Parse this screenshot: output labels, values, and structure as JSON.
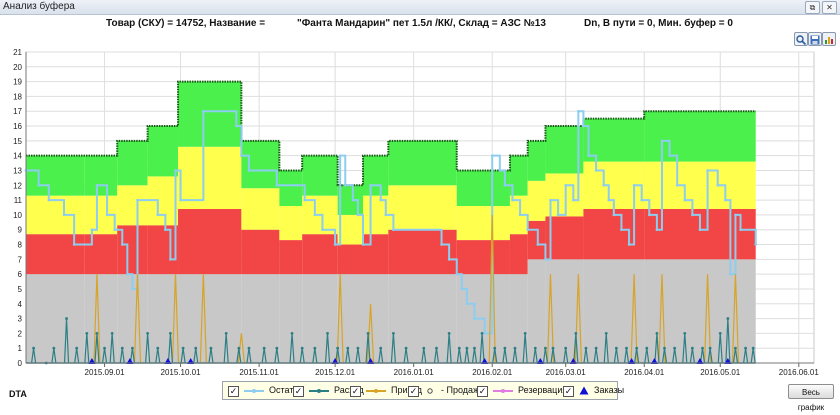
{
  "window": {
    "title": "Анализ буфера"
  },
  "info": {
    "product": "Товар (СКУ) = 14752, Название =",
    "name": "\"Фанта Мандарин\" пет 1.5л /КК/, Склад = АЗС №13",
    "buffer": "Dn, В пути = 0, Мин. буфер = 0"
  },
  "footer": {
    "label": "DTA",
    "button": "Весь график"
  },
  "toolbar": {
    "icons": [
      "zoom-icon",
      "save-icon",
      "chart-icon"
    ]
  },
  "chart_data": {
    "type": "line",
    "x_range": [
      "2015-08-01",
      "2016-06-07"
    ],
    "ylim": [
      0,
      21
    ],
    "yticks": [
      "0",
      "1",
      "2",
      "3",
      "4",
      "5",
      "6",
      "7",
      "8",
      "9",
      "10",
      "11",
      "12",
      "13",
      "14",
      "15",
      "16",
      "17",
      "18",
      "19",
      "20",
      "21"
    ],
    "xticks": [
      {
        "label": "2015.09.01",
        "date": "2015-09-01"
      },
      {
        "label": "2015.10.01",
        "date": "2015-10-01"
      },
      {
        "label": "2015.11.01",
        "date": "2015-11-01"
      },
      {
        "label": "2015.12.01",
        "date": "2015-12-01"
      },
      {
        "label": "2016.01.01",
        "date": "2016-01-01"
      },
      {
        "label": "2016.02.01",
        "date": "2016-02-01"
      },
      {
        "label": "2016.03.01",
        "date": "2016-03-01"
      },
      {
        "label": "2016.04.01",
        "date": "2016-04-01"
      },
      {
        "label": "2016.05.01",
        "date": "2016-05-01"
      },
      {
        "label": "2016.06.01",
        "date": "2016-06-01"
      }
    ],
    "grid": true,
    "zone_colors": {
      "gray": "#c8c8c8",
      "red": "#f24545",
      "yellow": "#ffff4d",
      "green": "#4cf04c"
    },
    "zones": [
      {
        "from": "2015-08-01",
        "to": "2015-08-24",
        "gray": 6,
        "red": 8.7,
        "yellow": 11.3,
        "green": 14
      },
      {
        "from": "2015-08-24",
        "to": "2015-09-06",
        "gray": 6,
        "red": 8.7,
        "yellow": 11.3,
        "green": 14
      },
      {
        "from": "2015-09-06",
        "to": "2015-09-18",
        "gray": 6,
        "red": 9.3,
        "yellow": 12.0,
        "green": 15
      },
      {
        "from": "2015-09-18",
        "to": "2015-09-30",
        "gray": 6,
        "red": 9.3,
        "yellow": 12.6,
        "green": 16
      },
      {
        "from": "2015-09-30",
        "to": "2015-10-25",
        "gray": 6,
        "red": 10.4,
        "yellow": 14.6,
        "green": 19
      },
      {
        "from": "2015-10-25",
        "to": "2015-11-09",
        "gray": 6,
        "red": 9.0,
        "yellow": 11.8,
        "green": 15
      },
      {
        "from": "2015-11-09",
        "to": "2015-11-18",
        "gray": 6,
        "red": 8.3,
        "yellow": 10.6,
        "green": 13
      },
      {
        "from": "2015-11-18",
        "to": "2015-12-02",
        "gray": 6,
        "red": 8.7,
        "yellow": 11.3,
        "green": 14
      },
      {
        "from": "2015-12-02",
        "to": "2015-12-12",
        "gray": 6,
        "red": 8.0,
        "yellow": 10.0,
        "green": 12
      },
      {
        "from": "2015-12-12",
        "to": "2015-12-22",
        "gray": 6,
        "red": 8.7,
        "yellow": 11.3,
        "green": 14
      },
      {
        "from": "2015-12-22",
        "to": "2016-01-18",
        "gray": 6,
        "red": 9.0,
        "yellow": 12.0,
        "green": 15
      },
      {
        "from": "2016-01-18",
        "to": "2016-02-08",
        "gray": 6,
        "red": 8.3,
        "yellow": 10.6,
        "green": 13
      },
      {
        "from": "2016-02-08",
        "to": "2016-02-15",
        "gray": 6,
        "red": 8.7,
        "yellow": 11.3,
        "green": 14
      },
      {
        "from": "2016-02-15",
        "to": "2016-02-22",
        "gray": 7,
        "red": 9.6,
        "yellow": 12.3,
        "green": 15
      },
      {
        "from": "2016-02-22",
        "to": "2016-03-08",
        "gray": 7,
        "red": 9.9,
        "yellow": 12.8,
        "green": 16
      },
      {
        "from": "2016-03-08",
        "to": "2016-04-01",
        "gray": 7,
        "red": 10.4,
        "yellow": 13.6,
        "green": 16.5
      },
      {
        "from": "2016-04-01",
        "to": "2016-05-15",
        "gray": 7,
        "red": 10.4,
        "yellow": 13.6,
        "green": 17
      }
    ],
    "series": [
      {
        "name": "Остаток",
        "color": "#8ccdf0",
        "step": true,
        "points": [
          [
            "2015-08-01",
            13
          ],
          [
            "2015-08-06",
            12
          ],
          [
            "2015-08-10",
            11
          ],
          [
            "2015-08-16",
            10
          ],
          [
            "2015-08-20",
            8
          ],
          [
            "2015-08-27",
            9
          ],
          [
            "2015-08-29",
            12
          ],
          [
            "2015-09-02",
            10
          ],
          [
            "2015-09-05",
            9
          ],
          [
            "2015-09-08",
            8
          ],
          [
            "2015-09-10",
            6
          ],
          [
            "2015-09-12",
            5
          ],
          [
            "2015-09-14",
            11
          ],
          [
            "2015-09-22",
            10
          ],
          [
            "2015-09-25",
            9
          ],
          [
            "2015-09-27",
            7
          ],
          [
            "2015-09-29",
            13
          ],
          [
            "2015-10-01",
            11
          ],
          [
            "2015-10-10",
            17
          ],
          [
            "2015-10-23",
            16
          ],
          [
            "2015-10-25",
            14
          ],
          [
            "2015-10-28",
            13
          ],
          [
            "2015-11-08",
            12
          ],
          [
            "2015-11-16",
            12
          ],
          [
            "2015-11-19",
            11
          ],
          [
            "2015-11-23",
            10
          ],
          [
            "2015-11-26",
            9
          ],
          [
            "2015-12-01",
            8
          ],
          [
            "2015-12-03",
            14
          ],
          [
            "2015-12-05",
            12
          ],
          [
            "2015-12-08",
            11
          ],
          [
            "2015-12-10",
            10
          ],
          [
            "2015-12-12",
            8
          ],
          [
            "2015-12-15",
            12
          ],
          [
            "2015-12-19",
            11
          ],
          [
            "2015-12-21",
            10
          ],
          [
            "2015-12-24",
            9
          ],
          [
            "2016-01-12",
            8
          ],
          [
            "2016-01-15",
            7
          ],
          [
            "2016-01-18",
            6
          ],
          [
            "2016-01-20",
            5
          ],
          [
            "2016-01-22",
            4
          ],
          [
            "2016-01-25",
            3
          ],
          [
            "2016-01-29",
            2
          ],
          [
            "2016-02-01",
            14
          ],
          [
            "2016-02-04",
            13
          ],
          [
            "2016-02-06",
            12
          ],
          [
            "2016-02-09",
            11
          ],
          [
            "2016-02-12",
            10
          ],
          [
            "2016-02-15",
            9
          ],
          [
            "2016-02-19",
            8
          ],
          [
            "2016-02-22",
            7
          ],
          [
            "2016-02-24",
            11
          ],
          [
            "2016-02-27",
            10
          ],
          [
            "2016-03-01",
            12
          ],
          [
            "2016-03-04",
            11
          ],
          [
            "2016-03-06",
            17
          ],
          [
            "2016-03-08",
            16
          ],
          [
            "2016-03-10",
            14
          ],
          [
            "2016-03-13",
            13
          ],
          [
            "2016-03-16",
            12
          ],
          [
            "2016-03-18",
            11
          ],
          [
            "2016-03-20",
            10
          ],
          [
            "2016-03-23",
            9
          ],
          [
            "2016-03-26",
            8
          ],
          [
            "2016-03-28",
            12
          ],
          [
            "2016-03-31",
            11
          ],
          [
            "2016-04-03",
            10
          ],
          [
            "2016-04-06",
            9
          ],
          [
            "2016-04-08",
            15
          ],
          [
            "2016-04-11",
            14
          ],
          [
            "2016-04-14",
            12
          ],
          [
            "2016-04-17",
            11
          ],
          [
            "2016-04-20",
            10
          ],
          [
            "2016-04-23",
            9
          ],
          [
            "2016-04-26",
            13
          ],
          [
            "2016-04-30",
            12
          ],
          [
            "2016-05-03",
            11
          ],
          [
            "2016-05-05",
            6
          ],
          [
            "2016-05-07",
            10
          ],
          [
            "2016-05-09",
            9
          ],
          [
            "2016-05-15",
            8
          ]
        ]
      },
      {
        "name": "Расход",
        "color": "#2d7f86",
        "marker": true,
        "points": [
          [
            "2015-08-04",
            1
          ],
          [
            "2015-08-09",
            0
          ],
          [
            "2015-08-12",
            1
          ],
          [
            "2015-08-17",
            3
          ],
          [
            "2015-08-21",
            1
          ],
          [
            "2015-08-25",
            2
          ],
          [
            "2015-08-29",
            2
          ],
          [
            "2015-09-01",
            1
          ],
          [
            "2015-09-04",
            2
          ],
          [
            "2015-09-08",
            1
          ],
          [
            "2015-09-12",
            1
          ],
          [
            "2015-09-18",
            2
          ],
          [
            "2015-09-22",
            1
          ],
          [
            "2015-09-27",
            2
          ],
          [
            "2015-10-02",
            1
          ],
          [
            "2015-10-07",
            1
          ],
          [
            "2015-10-13",
            1
          ],
          [
            "2015-10-19",
            2
          ],
          [
            "2015-10-24",
            1
          ],
          [
            "2015-10-28",
            1
          ],
          [
            "2015-11-03",
            1
          ],
          [
            "2015-11-08",
            1
          ],
          [
            "2015-11-14",
            2
          ],
          [
            "2015-11-18",
            1
          ],
          [
            "2015-11-23",
            1
          ],
          [
            "2015-11-28",
            2
          ],
          [
            "2015-12-02",
            1
          ],
          [
            "2015-12-06",
            1
          ],
          [
            "2015-12-10",
            1
          ],
          [
            "2015-12-14",
            2
          ],
          [
            "2015-12-19",
            1
          ],
          [
            "2015-12-24",
            2
          ],
          [
            "2015-12-29",
            1
          ],
          [
            "2016-01-05",
            1
          ],
          [
            "2016-01-10",
            1
          ],
          [
            "2016-01-15",
            2
          ],
          [
            "2016-01-19",
            1
          ],
          [
            "2016-01-22",
            1
          ],
          [
            "2016-01-25",
            1
          ],
          [
            "2016-01-28",
            2
          ],
          [
            "2016-02-02",
            1
          ],
          [
            "2016-02-06",
            1
          ],
          [
            "2016-02-10",
            1
          ],
          [
            "2016-02-14",
            2
          ],
          [
            "2016-02-18",
            1
          ],
          [
            "2016-02-22",
            1
          ],
          [
            "2016-02-25",
            1
          ],
          [
            "2016-03-01",
            1
          ],
          [
            "2016-03-05",
            2
          ],
          [
            "2016-03-09",
            1
          ],
          [
            "2016-03-13",
            1
          ],
          [
            "2016-03-17",
            2
          ],
          [
            "2016-03-21",
            1
          ],
          [
            "2016-03-25",
            1
          ],
          [
            "2016-03-29",
            1
          ],
          [
            "2016-04-02",
            1
          ],
          [
            "2016-04-06",
            2
          ],
          [
            "2016-04-09",
            1
          ],
          [
            "2016-04-13",
            1
          ],
          [
            "2016-04-17",
            2
          ],
          [
            "2016-04-20",
            1
          ],
          [
            "2016-04-24",
            1
          ],
          [
            "2016-04-27",
            1
          ],
          [
            "2016-05-01",
            2
          ],
          [
            "2016-05-04",
            3
          ],
          [
            "2016-05-07",
            1
          ],
          [
            "2016-05-11",
            1
          ],
          [
            "2016-05-14",
            1
          ]
        ]
      },
      {
        "name": "Приход",
        "color": "#d7a428",
        "points": [
          [
            "2015-08-29",
            6
          ],
          [
            "2015-09-14",
            6
          ],
          [
            "2015-09-29",
            6
          ],
          [
            "2015-10-10",
            6
          ],
          [
            "2015-10-25",
            2
          ],
          [
            "2015-12-03",
            6
          ],
          [
            "2015-12-15",
            4
          ],
          [
            "2016-02-01",
            10
          ],
          [
            "2016-02-24",
            6
          ],
          [
            "2016-03-06",
            6
          ],
          [
            "2016-03-28",
            6
          ],
          [
            "2016-04-08",
            6
          ],
          [
            "2016-04-26",
            6
          ],
          [
            "2016-05-07",
            6
          ]
        ]
      },
      {
        "name": "Продажа",
        "color": "#4a4a4a",
        "points": []
      },
      {
        "name": "Резервация",
        "color": "#e27ce2",
        "points": []
      },
      {
        "name": "Заказы",
        "color": "#1010d8",
        "points": [
          [
            "2015-08-27",
            0
          ],
          [
            "2015-09-11",
            0
          ],
          [
            "2015-09-26",
            0
          ],
          [
            "2015-10-05",
            0
          ],
          [
            "2015-12-01",
            0
          ],
          [
            "2015-12-15",
            0
          ],
          [
            "2016-01-29",
            0
          ],
          [
            "2016-02-20",
            0
          ],
          [
            "2016-03-04",
            0
          ],
          [
            "2016-03-27",
            0
          ],
          [
            "2016-04-05",
            0
          ],
          [
            "2016-04-23",
            0
          ],
          [
            "2016-05-04",
            0
          ]
        ]
      }
    ],
    "legend": [
      "Остаток",
      "Расход",
      "Приход",
      "- Продажа",
      "Резервация",
      "Заказы"
    ]
  }
}
